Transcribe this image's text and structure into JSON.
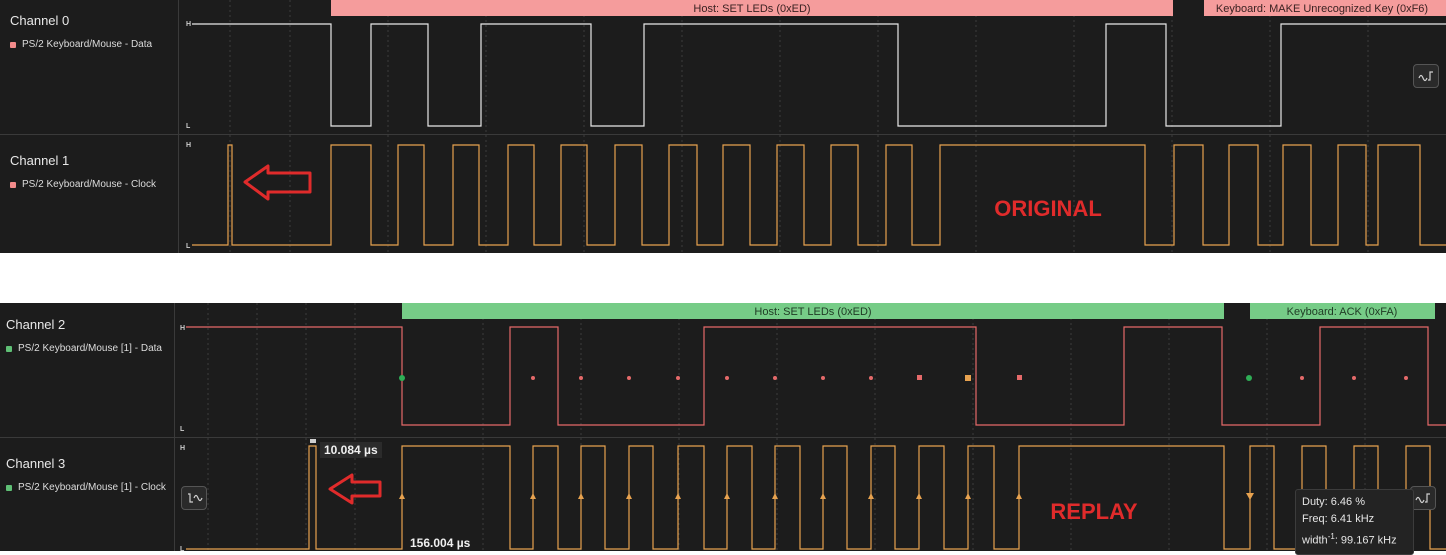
{
  "top": {
    "channels": [
      {
        "name": "Channel 0",
        "signal": "PS/2 Keyboard/Mouse - Data",
        "color": "#f28b8b"
      },
      {
        "name": "Channel 1",
        "signal": "PS/2 Keyboard/Mouse - Clock",
        "color": "#f28b8b"
      }
    ],
    "annotations": [
      {
        "text": "Host: SET LEDs (0xED)",
        "color": "#f59c9c"
      },
      {
        "text": "Keyboard: MAKE Unrecognized Key (0xF6)",
        "color": "#f59c9c"
      }
    ],
    "overlay_label": "ORIGINAL",
    "level_high": "H",
    "level_low": "L"
  },
  "bottom": {
    "channels": [
      {
        "name": "Channel 2",
        "signal": "PS/2 Keyboard/Mouse [1] - Data",
        "color": "#5fbf75"
      },
      {
        "name": "Channel 3",
        "signal": "PS/2 Keyboard/Mouse [1] - Clock",
        "color": "#5fbf75"
      }
    ],
    "annotations": [
      {
        "text": "Host: SET LEDs (0xED)",
        "color": "#76cc87"
      },
      {
        "text": "Keyboard: ACK (0xFA)",
        "color": "#76cc87"
      }
    ],
    "overlay_label": "REPLAY",
    "level_high": "H",
    "level_low": "L",
    "pulse_width": "10.084 µs",
    "period_width": "156.004 µs",
    "measurements": {
      "duty": "Duty: 6.46 %",
      "freq": "Freq: 6.41 kHz",
      "width_prefix": "width",
      "width_sup": "-1",
      "width_value": ": 99.167 kHz"
    }
  },
  "colors": {
    "data_trace_top": "#e8e8e8",
    "clock_trace": "#e7a24f",
    "data_trace_bottom": "#e56a6a",
    "arrow": "#e02b2b",
    "overlay_text": "#e02b2b",
    "grid": "#3c3c3c"
  }
}
